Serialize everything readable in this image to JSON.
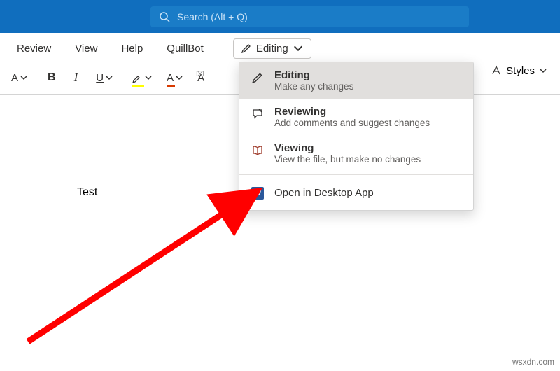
{
  "titlebar": {
    "search_placeholder": "Search (Alt + Q)"
  },
  "tabs": {
    "review": "Review",
    "view": "View",
    "help": "Help",
    "quillbot": "QuillBot"
  },
  "editing_button": {
    "label": "Editing"
  },
  "toolbar": {
    "font_size_letter": "A",
    "bold": "B",
    "italic": "I",
    "underline": "U",
    "styles_label": "Styles"
  },
  "document": {
    "body_text": "Test"
  },
  "menu": {
    "editing": {
      "title": "Editing",
      "desc": "Make any changes"
    },
    "reviewing": {
      "title": "Reviewing",
      "desc": "Add comments and suggest changes"
    },
    "viewing": {
      "title": "Viewing",
      "desc": "View the file, but make no changes"
    },
    "open_app": {
      "title": "Open in Desktop App"
    }
  },
  "watermark": "wsxdn.com"
}
